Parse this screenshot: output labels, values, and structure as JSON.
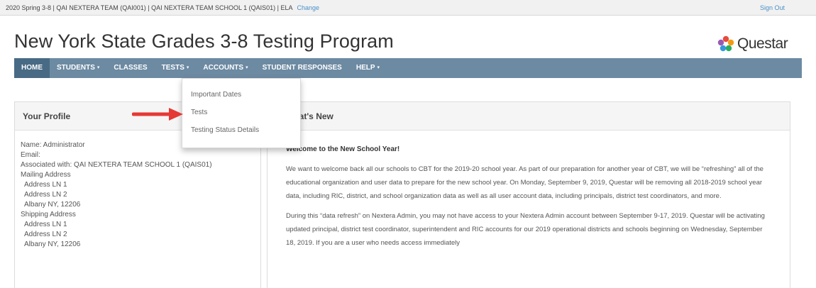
{
  "context_bar": {
    "text": "2020 Spring 3-8 | QAI NEXTERA TEAM (QAI001) | QAI NEXTERA TEAM SCHOOL 1 (QAIS01) | ELA",
    "change_link": "Change",
    "sign_out": "Sign Out"
  },
  "header": {
    "title": "New York State Grades 3-8 Testing Program",
    "logo_text": "Questar"
  },
  "nav": {
    "items": [
      {
        "label": "HOME",
        "caret": ""
      },
      {
        "label": "STUDENTS",
        "caret": "▾"
      },
      {
        "label": "CLASSES",
        "caret": ""
      },
      {
        "label": "TESTS",
        "caret": "▾"
      },
      {
        "label": "ACCOUNTS",
        "caret": "▾"
      },
      {
        "label": "STUDENT RESPONSES",
        "caret": ""
      },
      {
        "label": "HELP",
        "caret": "▾"
      }
    ]
  },
  "tests_menu": {
    "items": [
      "Important Dates",
      "Tests",
      "Testing Status Details"
    ]
  },
  "profile": {
    "heading": "Your Profile",
    "name_line": "Name: Administrator",
    "email_line": "Email:",
    "associated_line": "Associated with: QAI NEXTERA TEAM SCHOOL 1 (QAIS01)",
    "mailing_label": "Mailing Address",
    "mailing_1": "Address LN 1",
    "mailing_2": "Address LN 2",
    "mailing_3": "Albany NY, 12206",
    "shipping_label": "Shipping Address",
    "shipping_1": "Address LN 1",
    "shipping_2": "Address LN 2",
    "shipping_3": "Albany NY, 12206"
  },
  "news": {
    "heading": "What's New",
    "title": "Welcome to the New School Year!",
    "p1": "We want to welcome back all our schools to CBT for the 2019-20 school year. As part of our preparation for another year of CBT, we will be “refreshing” all of the educational organization and user data to prepare for the new school year. On Monday, September 9, 2019, Questar will be removing all 2018-2019 school year data, including RIC, district, and school organization data as well as all user account data, including principals, district test coordinators, and more.",
    "p2": "During this “data refresh” on Nextera Admin, you may not have access to your Nextera Admin account between September 9-17, 2019. Questar will be activating updated principal, district test coordinator, superintendent and RIC accounts for our 2019 operational districts and schools beginning on Wednesday, September 18, 2019. If you are a user who needs access immediately"
  },
  "colors": {
    "nav_bg": "#6c8aa2",
    "nav_active": "#486a85",
    "link": "#4a90c8",
    "arrow": "#e53935"
  }
}
